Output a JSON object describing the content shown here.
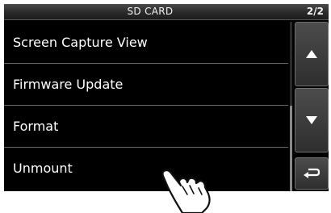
{
  "header": {
    "title": "SD CARD",
    "page_indicator": "2/2"
  },
  "menu": {
    "items": [
      {
        "label": "Screen Capture View"
      },
      {
        "label": "Firmware Update"
      },
      {
        "label": "Format"
      },
      {
        "label": "Unmount"
      }
    ]
  },
  "side_buttons": {
    "up_icon": "triangle-up-icon",
    "down_icon": "triangle-down-icon",
    "back_icon": "return-arrow-icon"
  },
  "colors": {
    "background": "#000000",
    "text": "#ffffff",
    "separator": "#6a6a6a"
  },
  "overlay": {
    "pointer_icon": "tapping-hand-icon"
  }
}
